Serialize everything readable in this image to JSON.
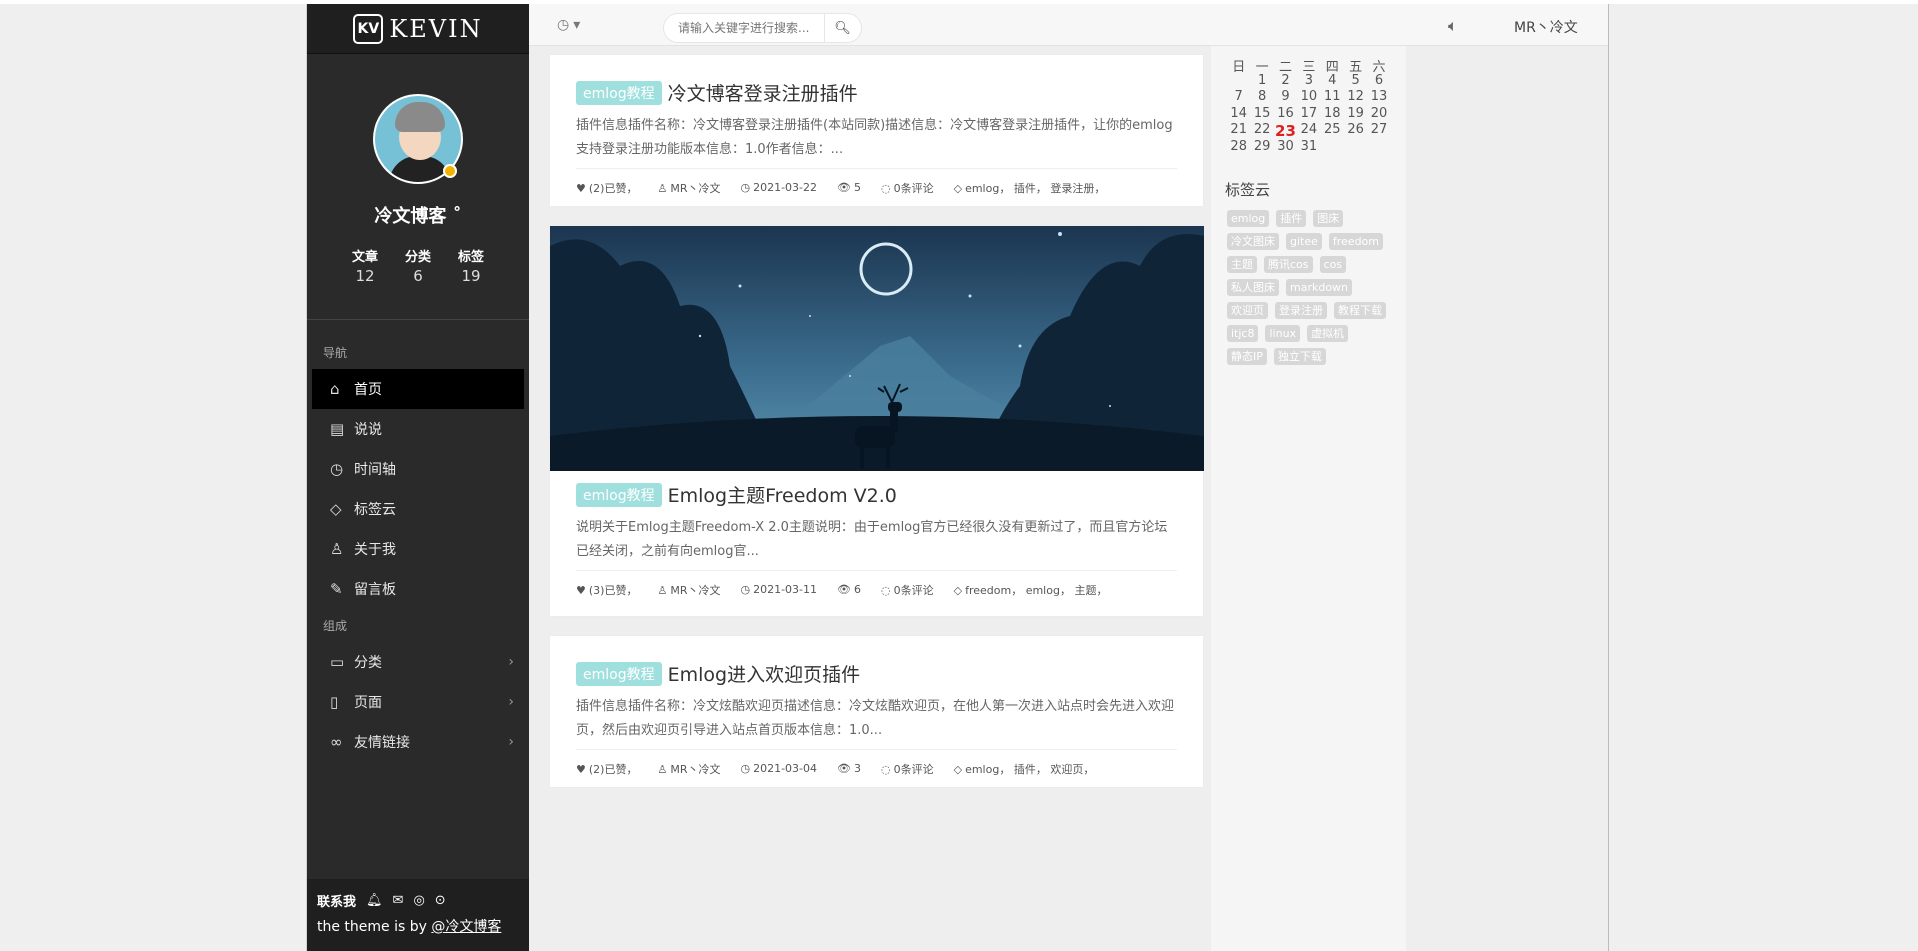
{
  "brand": {
    "logo_mark": "KV",
    "logo_text": "KEVIN"
  },
  "profile": {
    "name": "冷文博客 ˚",
    "stats": [
      {
        "label": "文章",
        "value": "12"
      },
      {
        "label": "分类",
        "value": "6"
      },
      {
        "label": "标签",
        "value": "19"
      }
    ]
  },
  "nav_section_1": "导航",
  "nav_main": [
    {
      "label": "首页",
      "icon": "home-icon"
    },
    {
      "label": "说说",
      "icon": "newspaper-icon"
    },
    {
      "label": "时间轴",
      "icon": "clock-icon"
    },
    {
      "label": "标签云",
      "icon": "tag-icon"
    },
    {
      "label": "关于我",
      "icon": "user-icon"
    },
    {
      "label": "留言板",
      "icon": "edit-icon"
    }
  ],
  "nav_section_2": "组成",
  "nav_group": [
    {
      "label": "分类",
      "icon": "folder-icon"
    },
    {
      "label": "页面",
      "icon": "file-icon"
    },
    {
      "label": "友情链接",
      "icon": "link-icon"
    }
  ],
  "footer": {
    "contact_label": "联系我",
    "credit_prefix": "the theme is by ",
    "credit_link": "@冷文博客"
  },
  "topbar": {
    "search_placeholder": "请输入关键字进行搜索...",
    "user": "MR丶冷文"
  },
  "posts": [
    {
      "category": "emlog教程",
      "title": "冷文博客登录注册插件",
      "excerpt": "插件信息插件名称：冷文博客登录注册插件(本站同款)描述信息：冷文博客登录注册插件，让你的emlog支持登录注册功能版本信息：1.0作者信息：...",
      "likes": "(2)已赞，",
      "author": "MR丶冷文",
      "date": "2021-03-22",
      "views": "5",
      "comments": "0条评论",
      "tags": "emlog，  插件，  登录注册，"
    },
    {
      "category": "emlog教程",
      "title": "Emlog主题Freedom V2.0",
      "excerpt": "说明关于Emlog主题Freedom-X 2.0主题说明：由于emlog官方已经很久没有更新过了，而且官方论坛已经关闭，之前有向emlog官...",
      "likes": "(3)已赞，",
      "author": "MR丶冷文",
      "date": "2021-03-11",
      "views": "6",
      "comments": "0条评论",
      "tags": "freedom，  emlog，  主题，"
    },
    {
      "category": "emlog教程",
      "title": "Emlog进入欢迎页插件",
      "excerpt": "插件信息插件名称：冷文炫酷欢迎页描述信息：冷文炫酷欢迎页，在他人第一次进入站点时会先进入欢迎页，然后由欢迎页引导进入站点首页版本信息：1.0...",
      "likes": "(2)已赞，",
      "author": "MR丶冷文",
      "date": "2021-03-04",
      "views": "3",
      "comments": "0条评论",
      "tags": "emlog，  插件，  欢迎页，"
    }
  ],
  "calendar": {
    "weekdays": [
      "日",
      "一",
      "二",
      "三",
      "四",
      "五",
      "六"
    ],
    "weeks": [
      [
        "",
        "1",
        "2",
        "3",
        "4",
        "5",
        "6"
      ],
      [
        "7",
        "8",
        "9",
        "10",
        "11",
        "12",
        "13"
      ],
      [
        "14",
        "15",
        "16",
        "17",
        "18",
        "19",
        "20"
      ],
      [
        "21",
        "22",
        "23",
        "24",
        "25",
        "26",
        "27"
      ],
      [
        "28",
        "29",
        "30",
        "31",
        "",
        "",
        ""
      ]
    ],
    "today": "23"
  },
  "tag_cloud_title": "标签云",
  "tag_cloud": [
    "emlog",
    "插件",
    "图床",
    "冷文图床",
    "gitee",
    "freedom",
    "主题",
    "腾讯cos",
    "cos",
    "私人图床",
    "markdown",
    "欢迎页",
    "登录注册",
    "教程下载",
    "itjc8",
    "linux",
    "虚拟机",
    "静态IP",
    "独立下载"
  ],
  "colors": {
    "sidebar_bg": "#2a2a2a",
    "category_badge": "#9fe0de",
    "today": "#e02020",
    "tag_bg": "#d7d7d7"
  }
}
